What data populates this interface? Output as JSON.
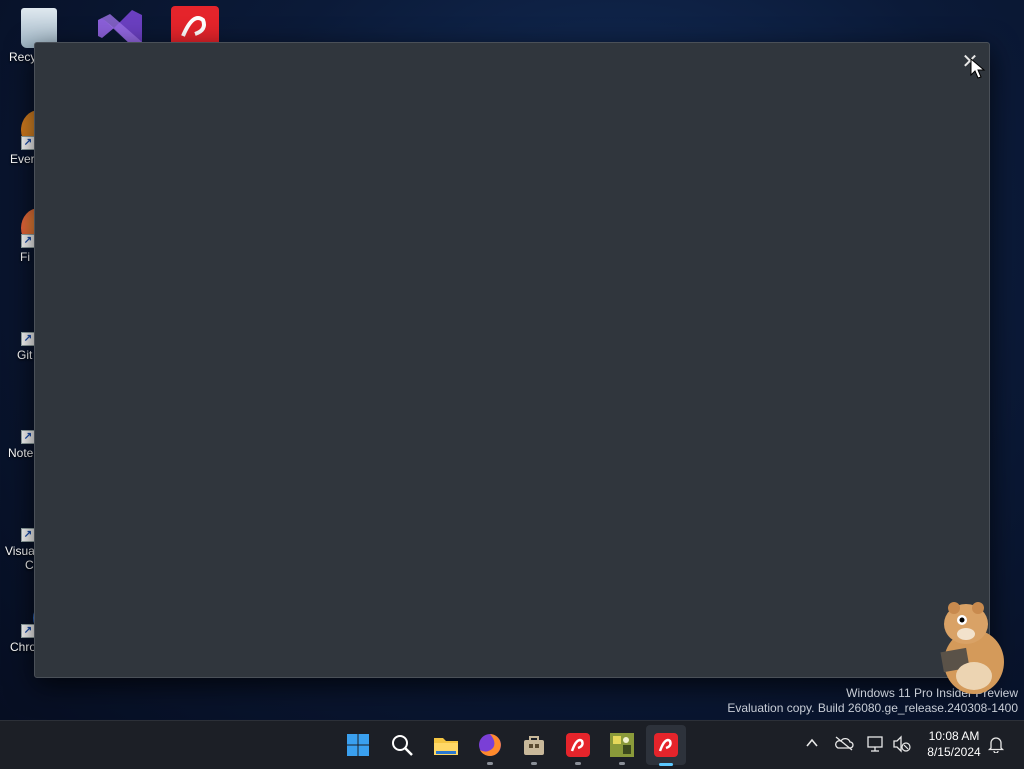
{
  "desktop_icons": [
    {
      "label": "Recy",
      "icon": "recycle-bin-icon"
    },
    {
      "label": "Ever",
      "icon": "evernote-icon"
    },
    {
      "label": "Fi",
      "icon": "firefox-icon"
    },
    {
      "label": "Git",
      "icon": "git-icon"
    },
    {
      "label": "Note",
      "icon": "notepad-icon"
    },
    {
      "label": "Visua",
      "label2": "C",
      "icon": "vscode-icon"
    },
    {
      "label": "Chro",
      "icon": "chrome-icon"
    }
  ],
  "top_icons": [
    {
      "icon": "visual-studio-icon"
    },
    {
      "icon": "avira-icon"
    }
  ],
  "window": {
    "close_glyph": "✕"
  },
  "watermark": {
    "line1": "Windows 11 Pro Insider Preview",
    "line2": "Evaluation copy. Build 26080.ge_release.240308-1400"
  },
  "taskbar": {
    "apps": [
      {
        "name": "start",
        "icon": "windows-start-icon"
      },
      {
        "name": "search",
        "icon": "search-icon"
      },
      {
        "name": "file-explorer",
        "icon": "folder-icon"
      },
      {
        "name": "firefox",
        "icon": "firefox-icon"
      },
      {
        "name": "store",
        "icon": "store-icon"
      },
      {
        "name": "avira",
        "icon": "avira-icon"
      },
      {
        "name": "app-thumbnail",
        "icon": "app-icon"
      },
      {
        "name": "avira-active",
        "icon": "avira-icon"
      }
    ],
    "tray": {
      "chevron": "^",
      "time": "10:08 AM",
      "date": "8/15/2024"
    }
  },
  "colors": {
    "window_bg": "#30363d",
    "taskbar_bg": "#1c1f26",
    "accent": "#5cc8ff",
    "avira_red": "#e5242b"
  }
}
